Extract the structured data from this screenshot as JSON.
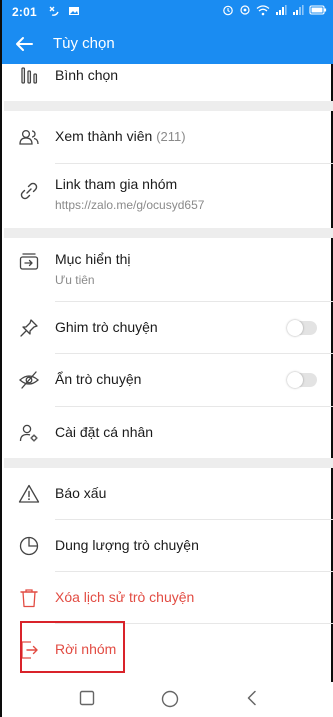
{
  "status_bar": {
    "time": "2:01",
    "icons_left": [
      "missed-call-icon",
      "image-notification-icon"
    ],
    "icons_right": [
      "alarm-icon",
      "sync-icon",
      "wifi-icon",
      "signal-icon",
      "signal-icon",
      "battery-icon"
    ]
  },
  "app_bar": {
    "title": "Tùy chọn"
  },
  "options": {
    "poll": {
      "label": "Bình chọn"
    },
    "members": {
      "label": "Xem thành viên",
      "count": "(211)"
    },
    "group_link": {
      "label": "Link tham gia nhóm",
      "url": "https://zalo.me/g/ocusyd657"
    },
    "display_folder": {
      "label": "Mục hiển thị",
      "value": "Ưu tiên"
    },
    "pin_chat": {
      "label": "Ghim trò chuyện",
      "toggle_on": false
    },
    "hide_chat": {
      "label": "Ẩn trò chuyện",
      "toggle_on": false
    },
    "personal_settings": {
      "label": "Cài đặt cá nhân"
    },
    "report": {
      "label": "Báo xấu"
    },
    "storage": {
      "label": "Dung lượng trò chuyện"
    },
    "clear_history": {
      "label": "Xóa lịch sử trò chuyện"
    },
    "leave_group": {
      "label": "Rời nhóm"
    }
  },
  "colors": {
    "brand_blue": "#1a8cf2",
    "danger_red": "#e24c43",
    "highlight_box": "#d9232a"
  },
  "nav_bar": {
    "buttons": [
      "recent-apps-icon",
      "home-icon",
      "back-icon"
    ]
  }
}
